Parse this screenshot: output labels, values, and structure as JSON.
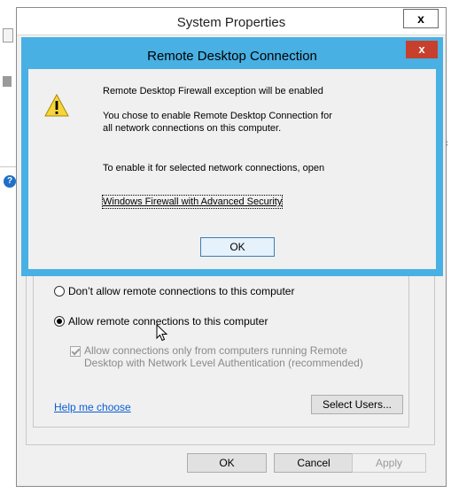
{
  "background": {
    "help_glyph": "?",
    "edge_letter": "c"
  },
  "system_properties": {
    "title": "System Properties",
    "close_glyph": "x",
    "radio_dont_allow": "Don’t allow remote connections to this computer",
    "radio_allow": "Allow remote connections to this computer",
    "nla_checkbox_line1": "Allow connections only from computers running Remote",
    "nla_checkbox_line2": "Desktop with Network Level Authentication (recommended)",
    "nla_checked": true,
    "help_link": "Help me choose",
    "select_users_button": "Select Users...",
    "ok_button": "OK",
    "cancel_button": "Cancel",
    "apply_button": "Apply",
    "selected_radio": "allow"
  },
  "rdc_dialog": {
    "title": "Remote Desktop Connection",
    "close_glyph": "x",
    "icon": "warning-icon",
    "heading": "Remote Desktop Firewall exception will be enabled",
    "message_line1": "You chose to enable Remote Desktop Connection for",
    "message_line2": "all network connections on this computer.",
    "instruction": "To enable it for selected network connections, open",
    "firewall_link": "Windows Firewall with Advanced Security",
    "ok_button": "OK",
    "accent_color": "#48b0e3",
    "close_color": "#c7402d"
  }
}
